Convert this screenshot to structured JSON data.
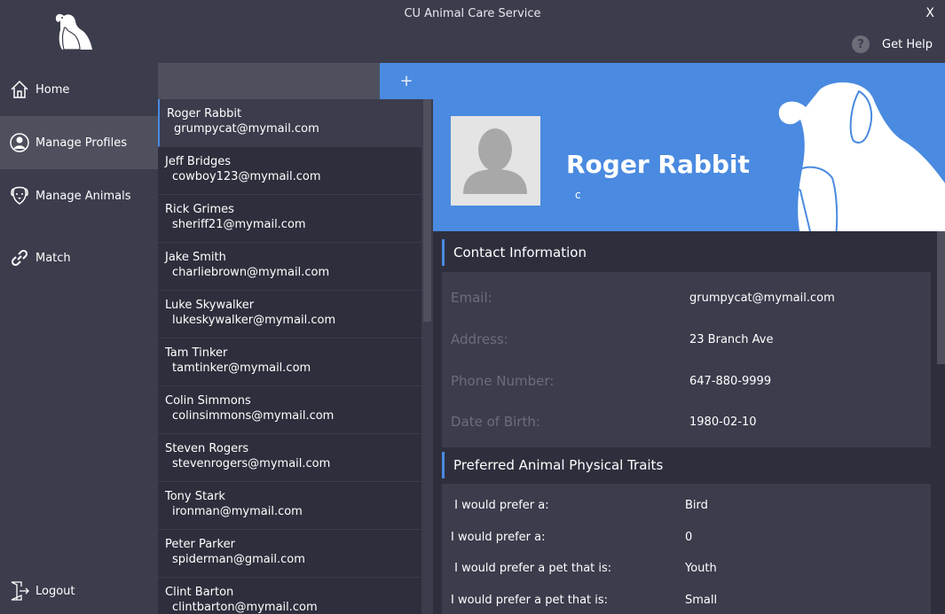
{
  "app": {
    "title": "CU Animal Care Service",
    "close_label": "X"
  },
  "help": {
    "icon_text": "?",
    "label": "Get Help"
  },
  "nav": {
    "items": [
      {
        "label": "Home"
      },
      {
        "label": "Manage Profiles"
      },
      {
        "label": "Manage Animals"
      },
      {
        "label": "Match"
      }
    ],
    "logout_label": "Logout"
  },
  "list": {
    "search_value": "",
    "add_label": "+",
    "profiles": [
      {
        "name": "Roger Rabbit",
        "email": "grumpycat@mymail.com"
      },
      {
        "name": "Jeff Bridges",
        "email": "cowboy123@mymail.com"
      },
      {
        "name": "Rick Grimes",
        "email": "sheriff21@mymail.com"
      },
      {
        "name": "Jake Smith",
        "email": "charliebrown@mymail.com"
      },
      {
        "name": "Luke Skywalker",
        "email": "lukeskywalker@mymail.com"
      },
      {
        "name": "Tam Tinker",
        "email": "tamtinker@mymail.com"
      },
      {
        "name": "Colin Simmons",
        "email": "colinsimmons@mymail.com"
      },
      {
        "name": "Steven Rogers",
        "email": "stevenrogers@mymail.com"
      },
      {
        "name": "Tony Stark",
        "email": "ironman@mymail.com"
      },
      {
        "name": "Peter Parker",
        "email": "spiderman@gmail.com"
      },
      {
        "name": "Clint Barton",
        "email": "clintbarton@mymail.com"
      }
    ]
  },
  "profile": {
    "name": "Roger Rabbit",
    "subtitle": "c",
    "contact": {
      "title": "Contact Information",
      "rows": [
        {
          "label": "Email:",
          "value": "grumpycat@mymail.com"
        },
        {
          "label": "Address:",
          "value": "23 Branch Ave"
        },
        {
          "label": "Phone Number:",
          "value": "647-880-9999"
        },
        {
          "label": "Date of Birth:",
          "value": "1980-02-10"
        }
      ]
    },
    "traits": {
      "title": "Preferred Animal Physical Traits",
      "rows": [
        {
          "label": " I would prefer a:",
          "value": "Bird"
        },
        {
          "label": "I would prefer a:",
          "value": "0"
        },
        {
          "label": " I would prefer a pet that is:",
          "value": "Youth"
        },
        {
          "label": "I would prefer a pet that is:",
          "value": "Small"
        }
      ]
    }
  },
  "colors": {
    "accent": "#4a8ae0",
    "background": "#3b3c4c",
    "panel": "#2e2f3d",
    "muted_label": "#6c6d7c"
  }
}
